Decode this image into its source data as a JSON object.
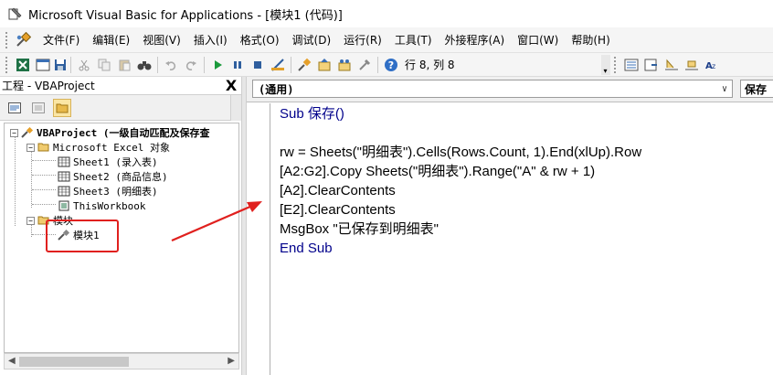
{
  "window": {
    "title": "Microsoft Visual Basic for Applications - [模块1 (代码)]"
  },
  "menubar": {
    "items": [
      {
        "label": "文件(F)"
      },
      {
        "label": "编辑(E)"
      },
      {
        "label": "视图(V)"
      },
      {
        "label": "插入(I)"
      },
      {
        "label": "格式(O)"
      },
      {
        "label": "调试(D)"
      },
      {
        "label": "运行(R)"
      },
      {
        "label": "工具(T)"
      },
      {
        "label": "外接程序(A)"
      },
      {
        "label": "窗口(W)"
      },
      {
        "label": "帮助(H)"
      }
    ]
  },
  "toolbar": {
    "cursor_position": "行 8, 列 8"
  },
  "project_pane": {
    "title": "工程 - VBAProject",
    "close_label": "X",
    "tree": {
      "root": "VBAProject (一级自动匹配及保存查",
      "excel_objects_folder": "Microsoft Excel 对象",
      "sheets": [
        "Sheet1 (录入表)",
        "Sheet2 (商品信息)",
        "Sheet3 (明细表)",
        "ThisWorkbook"
      ],
      "modules_folder": "模块",
      "modules": [
        "模块1"
      ]
    }
  },
  "code_pane": {
    "object_dropdown": "(通用)",
    "procedure_dropdown": "保存",
    "lines": [
      "Sub 保存()",
      "",
      "rw = Sheets(\"明细表\").Cells(Rows.Count, 1).End(xlUp).Row",
      "[A2:G2].Copy Sheets(\"明细表\").Range(\"A\" & rw + 1)",
      "[A2].ClearContents",
      "[E2].ClearContents",
      "MsgBox \"已保存到明细表\"",
      "End Sub"
    ]
  },
  "colors": {
    "keyword": "#00008b",
    "annotation": "#e0201e",
    "toolbar_bg": "#f5f5f5"
  }
}
